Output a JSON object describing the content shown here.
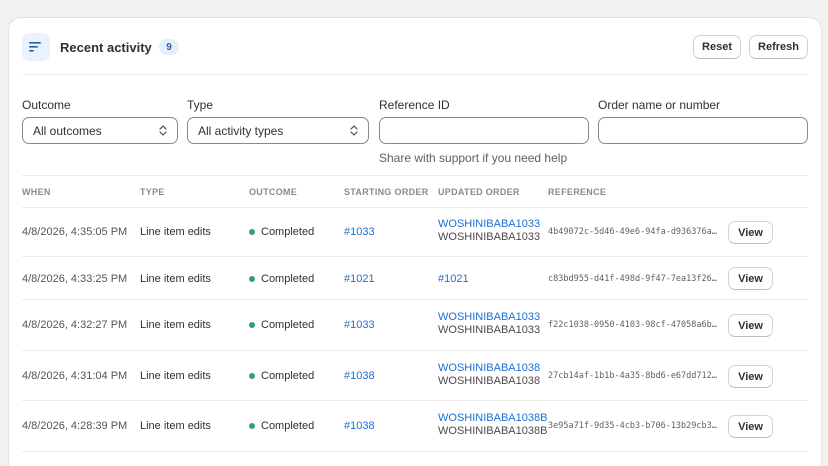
{
  "header": {
    "title": "Recent activity",
    "count": "9",
    "reset_label": "Reset",
    "refresh_label": "Refresh"
  },
  "filters": {
    "outcome": {
      "label": "Outcome",
      "value": "All outcomes"
    },
    "type": {
      "label": "Type",
      "value": "All activity types"
    },
    "reference": {
      "label": "Reference ID",
      "value": "",
      "help": "Share with support if you need help"
    },
    "order": {
      "label": "Order name or number",
      "value": ""
    }
  },
  "table": {
    "columns": [
      "WHEN",
      "TYPE",
      "OUTCOME",
      "STARTING ORDER",
      "UPDATED ORDER",
      "REFERENCE"
    ],
    "rows": [
      {
        "when": "4/8/2026, 4:35:05 PM",
        "type": "Line item edits",
        "outcome": "Completed",
        "starting_order": "#1033",
        "updated_order": "WOSHINIBABA1033",
        "updated_sub": "WOSHINIBABA1033",
        "reference": "4b49072c-5d46-49e6-94fa-d936376a…",
        "action": "View"
      },
      {
        "when": "4/8/2026, 4:33:25 PM",
        "type": "Line item edits",
        "outcome": "Completed",
        "starting_order": "#1021",
        "updated_order": "#1021",
        "updated_sub": "",
        "reference": "c83bd955-d41f-498d-9f47-7ea13f26…",
        "action": "View"
      },
      {
        "when": "4/8/2026, 4:32:27 PM",
        "type": "Line item edits",
        "outcome": "Completed",
        "starting_order": "#1033",
        "updated_order": "WOSHINIBABA1033",
        "updated_sub": "WOSHINIBABA1033",
        "reference": "f22c1038-0950-4103-98cf-47058a6b…",
        "action": "View"
      },
      {
        "when": "4/8/2026, 4:31:04 PM",
        "type": "Line item edits",
        "outcome": "Completed",
        "starting_order": "#1038",
        "updated_order": "WOSHINIBABA1038",
        "updated_sub": "WOSHINIBABA1038",
        "reference": "27cb14af-1b1b-4a35-8bd6-e67dd712…",
        "action": "View"
      },
      {
        "when": "4/8/2026, 4:28:39 PM",
        "type": "Line item edits",
        "outcome": "Completed",
        "starting_order": "#1038",
        "updated_order": "WOSHINIBABA1038B",
        "updated_sub": "WOSHINIBABA1038B",
        "reference": "3e95a71f-9d35-4cb3-b706-13b29cb3…",
        "action": "View"
      }
    ]
  },
  "colors": {
    "accent_link": "#1f6ed4",
    "status_completed": "#2ea36a",
    "badge_bg": "#e4effc"
  },
  "icons": {
    "header": "filter-lines-icon",
    "select": "select-chevron-icon",
    "status": "status-dot-icon"
  }
}
